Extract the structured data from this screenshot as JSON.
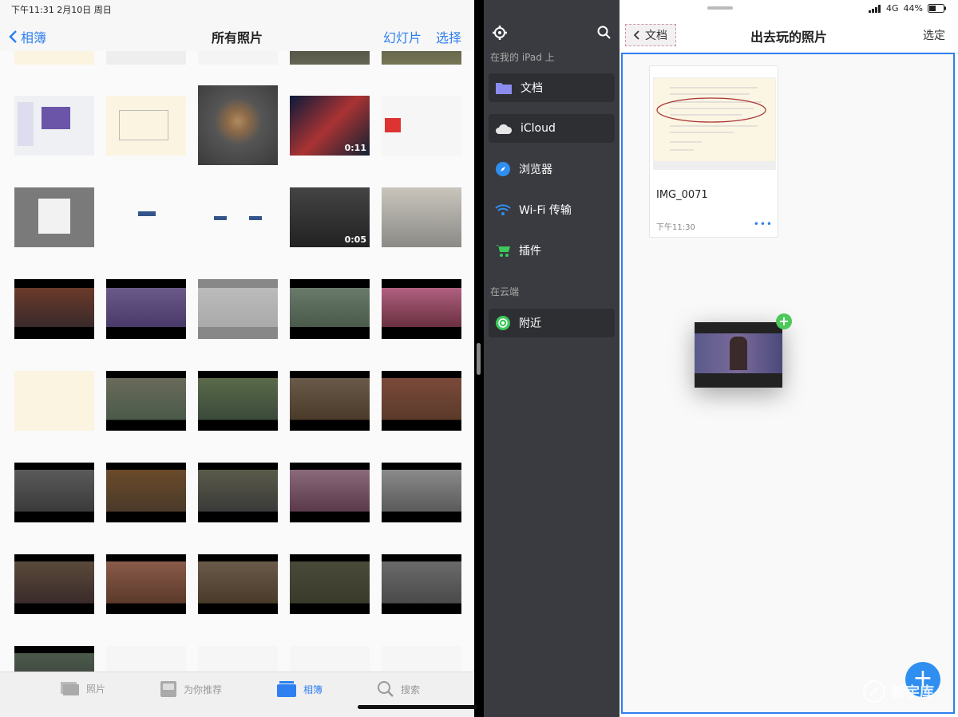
{
  "status": {
    "time_date": "下午11:31  2月10日 周日",
    "signal": "4G",
    "battery": "44%"
  },
  "photos": {
    "back_label": "相簿",
    "title": "所有照片",
    "slideshow": "幻灯片",
    "select": "选择",
    "durations": [
      "0:11",
      "0:05"
    ]
  },
  "tabbar": {
    "tabs": [
      {
        "label": "照片",
        "icon": "photos-icon",
        "active": false
      },
      {
        "label": "为你推荐",
        "icon": "for-you-icon",
        "active": false
      },
      {
        "label": "相簿",
        "icon": "albums-icon",
        "active": true
      },
      {
        "label": "搜索",
        "icon": "search-icon",
        "active": false
      }
    ]
  },
  "sidebar": {
    "section_local": "在我的 iPad 上",
    "section_cloud": "在云端",
    "items": [
      {
        "label": "文档",
        "icon": "folder-icon",
        "color": "#8c8cf0"
      },
      {
        "label": "iCloud",
        "icon": "cloud-icon",
        "color": "#e6e6e6"
      },
      {
        "label": "浏览器",
        "icon": "compass-icon",
        "color": "#2f8ff0"
      },
      {
        "label": "Wi-Fi 传输",
        "icon": "wifi-icon",
        "color": "#2f8ff0"
      },
      {
        "label": "插件",
        "icon": "cart-icon",
        "color": "#3cc85a"
      },
      {
        "label": "附近",
        "icon": "nearby-icon",
        "color": "#3cc85a"
      }
    ]
  },
  "files": {
    "back_label": "文档",
    "title": "出去玩的照片",
    "select": "选定",
    "card": {
      "name": "IMG_0071",
      "time": "下午11:30",
      "more": "•••"
    },
    "fab": "+"
  },
  "watermark": "新宇库"
}
